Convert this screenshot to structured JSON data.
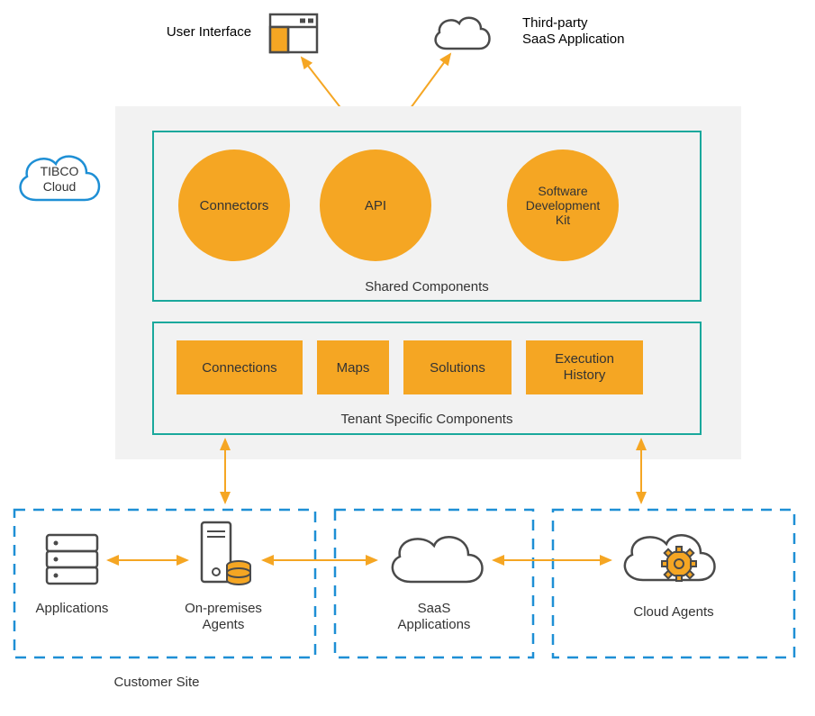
{
  "top": {
    "ui_label": "User Interface",
    "saas_label_line1": "Third-party",
    "saas_label_line2": "SaaS Application"
  },
  "cloud": {
    "tibco_line1": "TIBCO",
    "tibco_line2": "Cloud",
    "shared_title": "Shared Components",
    "tenant_title": "Tenant Specific Components",
    "circles": {
      "connectors": "Connectors",
      "api": "API",
      "sdk_line1": "Software",
      "sdk_line2": "Development",
      "sdk_line3": "Kit"
    },
    "tenant_boxes": {
      "connections": "Connections",
      "maps": "Maps",
      "solutions": "Solutions",
      "exec_line1": "Execution",
      "exec_line2": "History"
    }
  },
  "bottom": {
    "applications": "Applications",
    "onprem_line1": "On-premises",
    "onprem_line2": "Agents",
    "saas_apps_line1": "SaaS",
    "saas_apps_line2": "Applications",
    "cloud_agents": "Cloud Agents",
    "customer_site": "Customer Site"
  },
  "colors": {
    "orange": "#f5a623",
    "teal": "#1aa89c",
    "blue": "#1e8fd5",
    "gray": "#4a4a4a",
    "lightgray": "#f2f2f2"
  }
}
